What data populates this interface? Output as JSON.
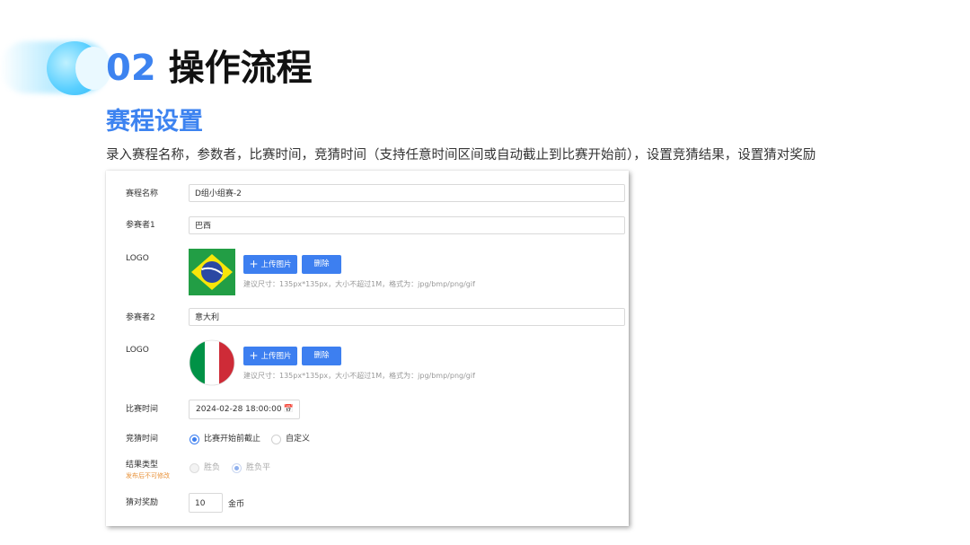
{
  "header": {
    "number": "02",
    "title": "操作流程"
  },
  "section": {
    "title": "赛程设置",
    "description": "录入赛程名称，参数者，比赛时间，竞猜时间（支持任意时间区间或自动截止到比赛开始前），设置竞猜结果，设置猜对奖励"
  },
  "form": {
    "match_name": {
      "label": "赛程名称",
      "value": "D组小组赛-2"
    },
    "participant1": {
      "label": "参赛者1",
      "value": "巴西",
      "logo_label": "LOGO",
      "upload_label": "上传图片",
      "delete_label": "删除",
      "hint": "建议尺寸：135px*135px，大小不超过1M，格式为：jpg/bmp/png/gif"
    },
    "participant2": {
      "label": "参赛者2",
      "value": "意大利",
      "logo_label": "LOGO",
      "upload_label": "上传图片",
      "delete_label": "删除",
      "hint": "建议尺寸：135px*135px，大小不超过1M，格式为：jpg/bmp/png/gif"
    },
    "match_time": {
      "label": "比赛时间",
      "value": "2024-02-28 18:00:00"
    },
    "guess_time": {
      "label": "竞猜时间",
      "options": [
        "比赛开始前截止",
        "自定义"
      ],
      "selected": "比赛开始前截止"
    },
    "result_type": {
      "label": "结果类型",
      "note": "发布后不可修改",
      "options": [
        "胜负",
        "胜负平"
      ],
      "selected": "胜负平"
    },
    "reward": {
      "label": "猜对奖励",
      "value": "10",
      "unit": "金币"
    }
  },
  "colors": {
    "accent": "#3d83f0",
    "button": "#3d7ff0",
    "warning": "#e8923a"
  }
}
